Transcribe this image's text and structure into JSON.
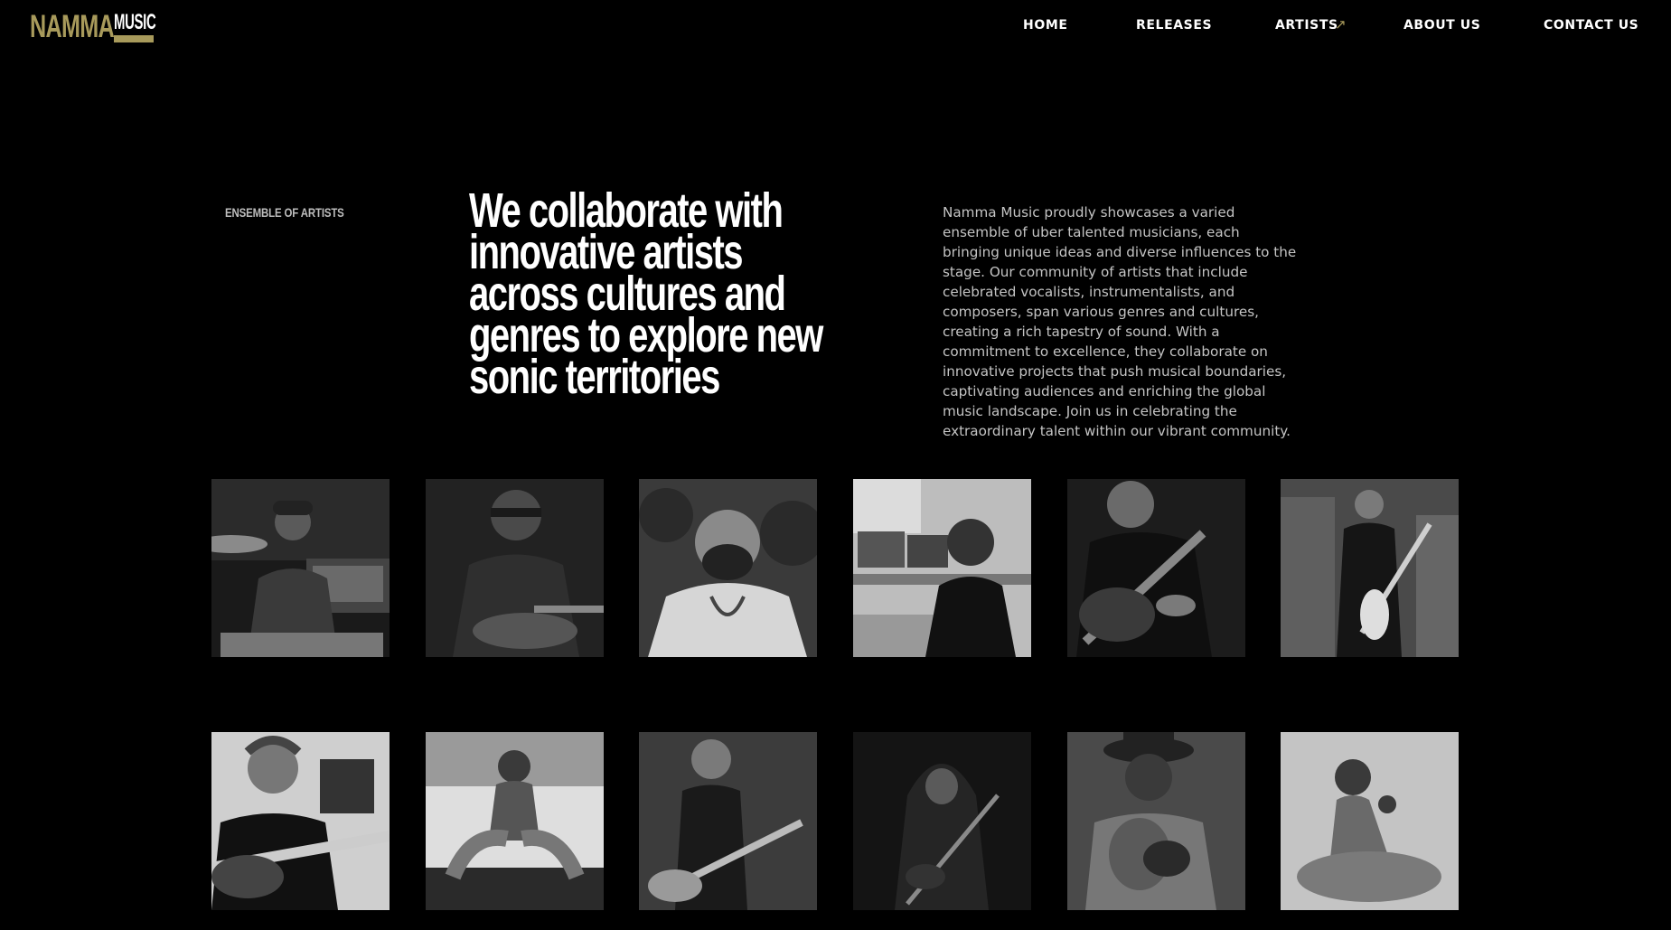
{
  "brand": {
    "name_primary": "NAMMA",
    "name_secondary": "MUSIC",
    "accent": "#a89a5b"
  },
  "nav": {
    "items": [
      {
        "label": "HOME"
      },
      {
        "label": "RELEASES"
      },
      {
        "label": "ARTISTS"
      },
      {
        "label": "ABOUT US"
      },
      {
        "label": "CONTACT US"
      }
    ],
    "external_icon": "arrow-up-right-icon"
  },
  "intro": {
    "eyebrow": "ENSEMBLE OF ARTISTS",
    "headline": "We collaborate with innovative artists across cultures and genres to explore new sonic territories",
    "description": "Namma Music proudly showcases a varied ensemble of uber talented musicians, each bringing unique ideas and diverse influences to the stage. Our community of artists that include celebrated vocalists, instrumentalists, and composers, span various genres and cultures, creating a rich tapestry of sound. With a commitment to excellence, they collaborate on innovative projects that push musical boundaries, captivating audiences and enriching the global music landscape. Join us in celebrating the extraordinary talent within our vibrant community."
  },
  "artists": [
    {
      "photo": "drummer-with-cap-photo"
    },
    {
      "photo": "guitarist-with-glasses-photo"
    },
    {
      "photo": "smiling-bearded-man-photo"
    },
    {
      "photo": "producer-in-studio-photo"
    },
    {
      "photo": "acoustic-guitarist-photo"
    },
    {
      "photo": "electric-guitarist-warehouse-photo"
    },
    {
      "photo": "curly-haired-guitarist-photo"
    },
    {
      "photo": "man-sitting-outdoors-photo"
    },
    {
      "photo": "bass-player-photo"
    },
    {
      "photo": "hooded-guitarist-photo"
    },
    {
      "photo": "man-with-hat-instrument-photo"
    },
    {
      "photo": "seated-dancer-photo"
    }
  ]
}
